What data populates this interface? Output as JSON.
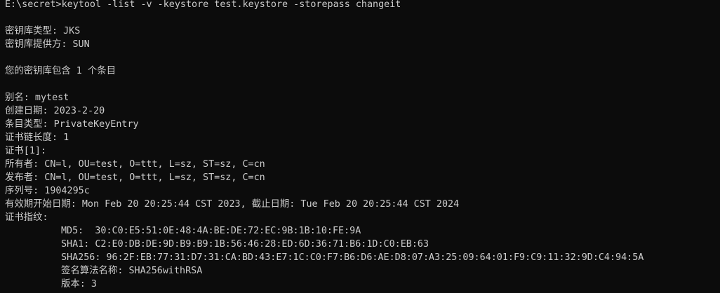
{
  "terminal": {
    "background": "#0c0c0c",
    "foreground": "#cccccc",
    "lines": [
      {
        "text": "E:\\secret>keytool -list -v -keystore test.keystore -storepass changeit",
        "indent": false
      },
      {
        "text": "",
        "indent": false
      },
      {
        "text": "密钥库类型: JKS",
        "indent": false
      },
      {
        "text": "密钥库提供方: SUN",
        "indent": false
      },
      {
        "text": "",
        "indent": false
      },
      {
        "text": "您的密钥库包含 1 个条目",
        "indent": false
      },
      {
        "text": "",
        "indent": false
      },
      {
        "text": "别名: mytest",
        "indent": false
      },
      {
        "text": "创建日期: 2023-2-20",
        "indent": false
      },
      {
        "text": "条目类型: PrivateKeyEntry",
        "indent": false
      },
      {
        "text": "证书链长度: 1",
        "indent": false
      },
      {
        "text": "证书[1]:",
        "indent": false
      },
      {
        "text": "所有者: CN=l, OU=test, O=ttt, L=sz, ST=sz, C=cn",
        "indent": false
      },
      {
        "text": "发布者: CN=l, OU=test, O=ttt, L=sz, ST=sz, C=cn",
        "indent": false
      },
      {
        "text": "序列号: 1904295c",
        "indent": false
      },
      {
        "text": "有效期开始日期: Mon Feb 20 20:25:44 CST 2023, 截止日期: Tue Feb 20 20:25:44 CST 2024",
        "indent": false
      },
      {
        "text": "证书指纹:",
        "indent": false
      },
      {
        "text": "MD5:  30:C0:E5:51:0E:48:4A:BE:DE:72:EC:9B:1B:10:FE:9A",
        "indent": true
      },
      {
        "text": "SHA1: C2:E0:DB:DE:9D:B9:B9:1B:56:46:28:ED:6D:36:71:B6:1D:C0:EB:63",
        "indent": true
      },
      {
        "text": "SHA256: 96:2F:EB:77:31:D7:31:CA:BD:43:E7:1C:C0:F7:B6:D6:AE:D8:07:A3:25:09:64:01:F9:C9:11:32:9D:C4:94:5A",
        "indent": true
      },
      {
        "text": "签名算法名称: SHA256withRSA",
        "indent": true
      },
      {
        "text": "版本: 3",
        "indent": true
      }
    ]
  }
}
